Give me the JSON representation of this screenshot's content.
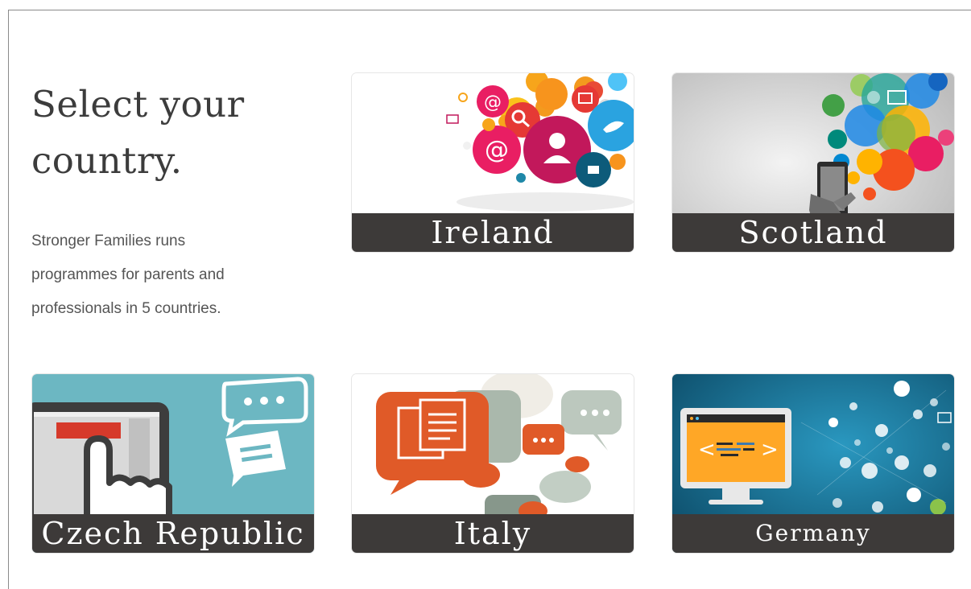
{
  "heading": {
    "line1": "Select your",
    "line2": "country."
  },
  "intro": "Stronger Families runs programmes for parents and professionals in 5 countries.",
  "countries": [
    {
      "name": "Ireland",
      "icon": "social-media-bubbles"
    },
    {
      "name": "Scotland",
      "icon": "phone-network-bubbles"
    },
    {
      "name": "Czech Republic",
      "icon": "touch-screen-chat"
    },
    {
      "name": "Italy",
      "icon": "document-speech-bubbles"
    },
    {
      "name": "Germany",
      "icon": "computer-code-network"
    }
  ],
  "colors": {
    "label_bg": "#3d3a39",
    "czech_bg": "#6cb7c2",
    "germany_bg": "#146c8c",
    "scotland_bg": "#cfcfcf"
  }
}
